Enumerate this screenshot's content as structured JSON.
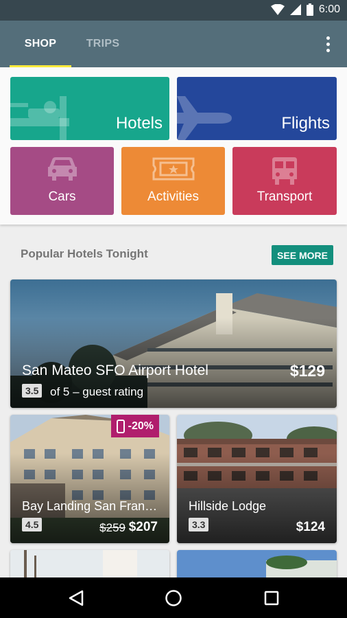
{
  "status_bar": {
    "time": "6:00",
    "icons": [
      "wifi-icon",
      "signal-icon",
      "battery-icon"
    ]
  },
  "tabs": [
    {
      "label": "SHOP",
      "selected": true
    },
    {
      "label": "TRIPS",
      "selected": false
    }
  ],
  "menu_icon": "overflow-menu-icon",
  "categories": {
    "hotels": {
      "label": "Hotels",
      "icon": "bed-icon",
      "color": "#17a68c"
    },
    "flights": {
      "label": "Flights",
      "icon": "airplane-icon",
      "color": "#24479b"
    },
    "cars": {
      "label": "Cars",
      "icon": "car-icon",
      "color": "#a54b85"
    },
    "activities": {
      "label": "Activities",
      "icon": "ticket-icon",
      "color": "#ed8a36"
    },
    "transport": {
      "label": "Transport",
      "icon": "bus-icon",
      "color": "#c93b5b"
    }
  },
  "popular": {
    "title": "Popular Hotels Tonight",
    "see_more_label": "SEE MORE"
  },
  "hotels": {
    "featured": {
      "name": "San Mateo SFO Airport Hotel",
      "price": "$129",
      "rating": "3.5",
      "rating_suffix": "of 5 – guest rating"
    },
    "bay_landing": {
      "name": "Bay Landing San Franci…",
      "rating": "4.5",
      "old_price": "$259",
      "price": "$207",
      "deal": "-20%",
      "deal_icon": "mobile-phone-icon"
    },
    "hillside": {
      "name": "Hillside Lodge",
      "rating": "3.3",
      "price": "$124"
    }
  },
  "nav": {
    "icons": [
      "back-icon",
      "home-icon",
      "recents-icon"
    ]
  },
  "colors": {
    "status_bar": "#37474f",
    "app_bar": "#546e7a",
    "tab_indicator": "#ffeb3b",
    "see_more": "#138f7d",
    "deal_badge": "#b01e6d"
  }
}
